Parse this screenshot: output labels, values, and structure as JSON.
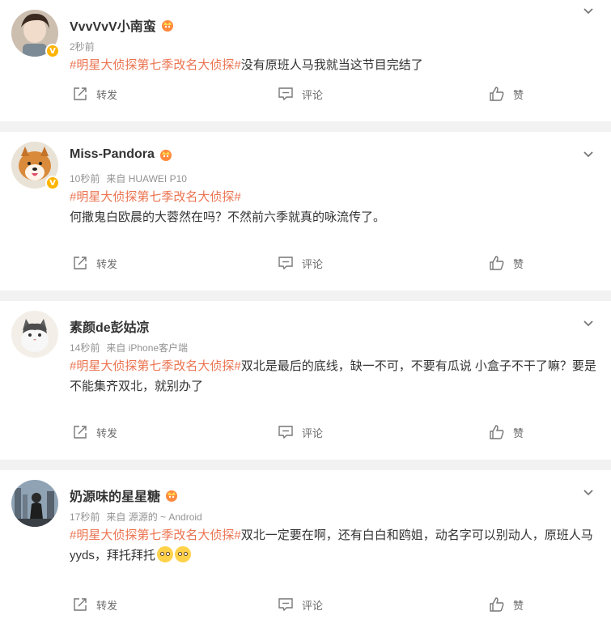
{
  "colors": {
    "tag": "#eb7350",
    "badge": "#ffb400",
    "meta": "#939393"
  },
  "posts": [
    {
      "name": "VvvVvV小南蛮",
      "time": "2秒前",
      "source": "",
      "tag": "#明星大侦探第七季改名大侦探#",
      "text": "没有原班人马我就当这节目完结了",
      "emojis": 0
    },
    {
      "name": "Miss-Pandora",
      "time": "10秒前",
      "source": "来自 HUAWEI P10",
      "tag": "#明星大侦探第七季改名大侦探#",
      "text": "何撒鬼白欧晨的大蓉然在吗？不然前六季就真的咏流传了。",
      "emojis": 0
    },
    {
      "name": "素颜de彭姑凉",
      "time": "14秒前",
      "source": "来自 iPhone客户端",
      "tag": "#明星大侦探第七季改名大侦探#",
      "text": "双北是最后的底线，缺一不可，不要有瓜说 小盒子不干了嘛？要是不能集齐双北，就别办了",
      "emojis": 0
    },
    {
      "name": "奶源味的星星糖",
      "time": "17秒前",
      "source": "来自 源源的 ~ Android",
      "tag": "#明星大侦探第七季改名大侦探#",
      "text": "双北一定要在啊，还有白白和鸥姐，动名字可以别动人，原班人马yyds，拜托拜托",
      "emojis": 2
    }
  ],
  "actions": {
    "repost": "转发",
    "comment": "评论",
    "like": "赞"
  },
  "icons": {
    "verified": "V",
    "crown": "crown-icon",
    "chevron": "chevron-down-icon"
  }
}
